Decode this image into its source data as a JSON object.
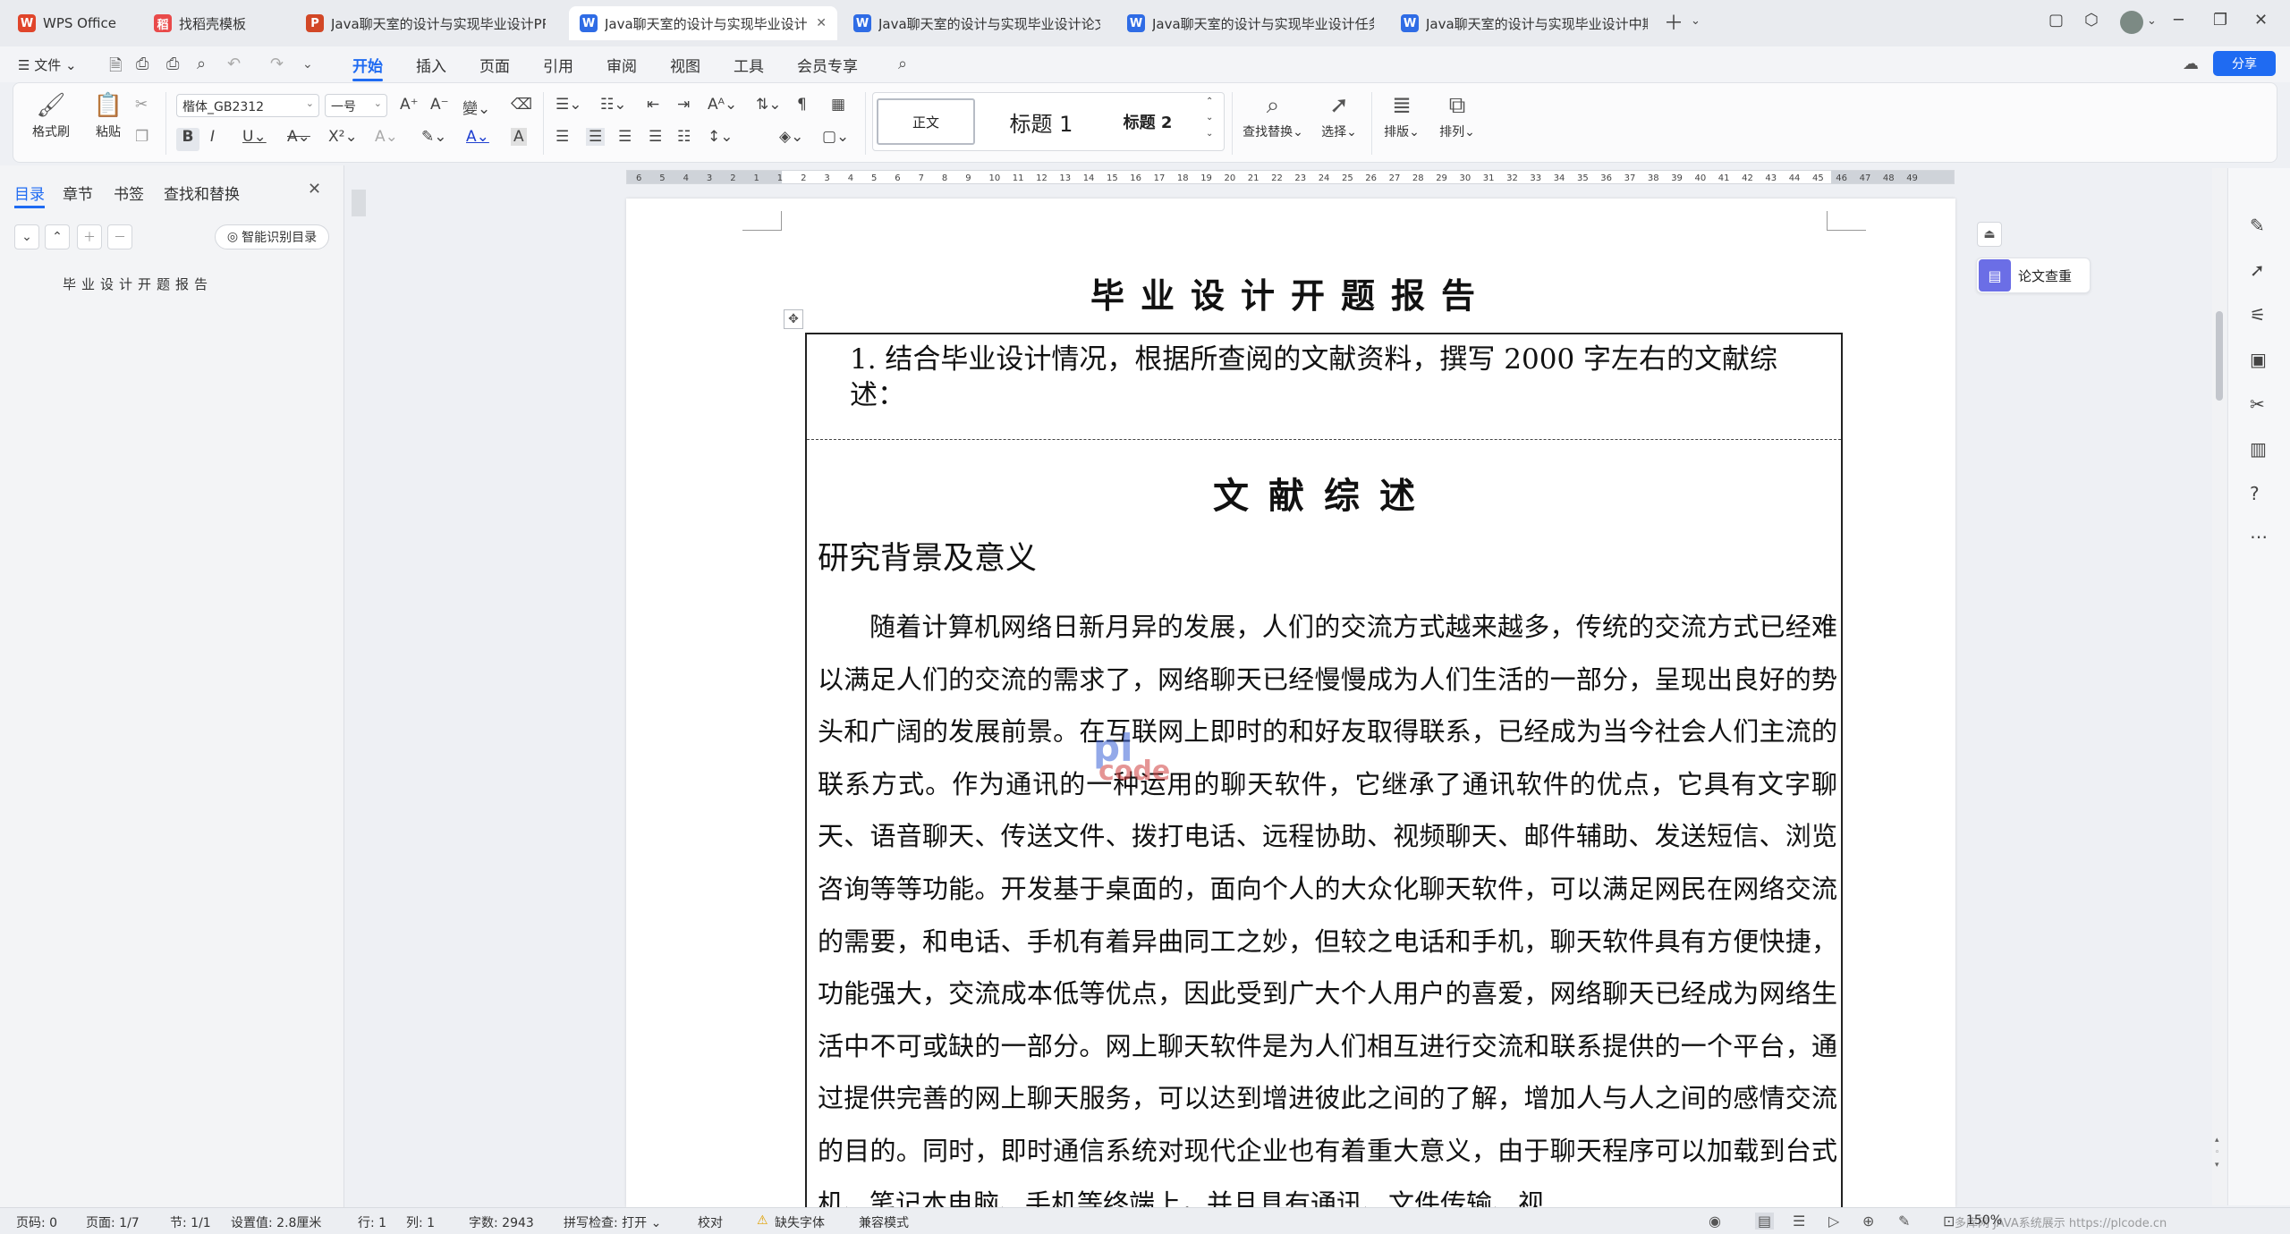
{
  "tabs": [
    {
      "label": "WPS Office",
      "icon": "W",
      "icon_color": "#e0452b"
    },
    {
      "label": "找稻壳模板",
      "icon": "稻",
      "icon_color": "#e94a4a"
    },
    {
      "label": "Java聊天室的设计与实现毕业设计PPT",
      "icon": "P",
      "icon_color": "#d24726"
    },
    {
      "label": "Java聊天室的设计与实现毕业设计开题报告",
      "icon": "W",
      "icon_color": "#2f6ce5"
    },
    {
      "label": "Java聊天室的设计与实现毕业设计论文",
      "icon": "W",
      "icon_color": "#2f6ce5"
    },
    {
      "label": "Java聊天室的设计与实现毕业设计任务书",
      "icon": "W",
      "icon_color": "#2f6ce5"
    },
    {
      "label": "Java聊天室的设计与实现毕业设计中期",
      "icon": "W",
      "icon_color": "#2f6ce5"
    }
  ],
  "menubar": {
    "file": "文件",
    "items": [
      "开始",
      "插入",
      "页面",
      "引用",
      "审阅",
      "视图",
      "工具",
      "会员专享"
    ],
    "share": "分享"
  },
  "ribbon": {
    "format_painter": "格式刷",
    "paste": "粘贴",
    "font_name": "楷体_GB2312",
    "font_size": "一号",
    "styles": [
      "正文",
      "标题 1",
      "标题 2"
    ],
    "find_replace": "查找替换",
    "select": "选择",
    "typeset": "排版",
    "arrange": "排列"
  },
  "nav": {
    "tabs": [
      "目录",
      "章节",
      "书签",
      "查找和替换"
    ],
    "smart_toc": "智能识别目录",
    "toc_entry": "毕业设计开题报告"
  },
  "ruler_numbers": "6 5 4 3 2 1 1 2 3 4 5 6 7 8 9 10 11 12 13 14 15 16 17 18 19 20 21 22 23 24 25 26 27 28 29 30 31 32 33 34 35 36 37 38 39 40 41 42 43 44 45 46 47 48 49",
  "document": {
    "title": "毕业设计开题报告",
    "question": "1. 结合毕业设计情况，根据所查阅的文献资料，撰写 2000 字左右的文献综述：",
    "lit_title": "文献综述",
    "section_heading": "研究背景及意义",
    "paragraph": "随着计算机网络日新月异的发展，人们的交流方式越来越多，传统的交流方式已经难以满足人们的交流的需求了，网络聊天已经慢慢成为人们生活的一部分，呈现出良好的势头和广阔的发展前景。在互联网上即时的和好友取得联系，已经成为当今社会人们主流的联系方式。作为通讯的一种运用的聊天软件，它继承了通讯软件的优点，它具有文字聊天、语音聊天、传送文件、拨打电话、远程协助、视频聊天、邮件辅助、发送短信、浏览咨询等等功能。开发基于桌面的，面向个人的大众化聊天软件，可以满足网民在网络交流的需要，和电话、手机有着异曲同工之妙，但较之电话和手机，聊天软件具有方便快捷，功能强大，交流成本低等优点，因此受到广大个人用户的喜爱，网络聊天已经成为网络生活中不可或缺的一部分。网上聊天软件是为人们相互进行交流和联系提供的一个平台，通过提供完善的网上聊天服务，可以达到增进彼此之间的了解，增加人与人之间的感情交流的目的。同时，即时通信系统对现代企业也有着重大意义，由于聊天程序可以加载到台式机、笔记本电脑、手机等终端上，并且具有通讯、文件传输、视",
    "watermark_top": "pl",
    "watermark_bottom": "code"
  },
  "side": {
    "paper_check": "论文查重"
  },
  "status": {
    "page_num": "页码: 0",
    "pages": "页面: 1/7",
    "section": "节: 1/1",
    "setting": "设置值: 2.8厘米",
    "row": "行: 1",
    "col": "列: 1",
    "word_count": "字数: 2943",
    "spell_check": "拼写检查: 打开",
    "proofread": "校对",
    "missing_font": "缺失字体",
    "compat": "兼容模式",
    "zoom": "150%",
    "footer_text": "多库网 JAVA系统展示 https://plcode.cn"
  }
}
